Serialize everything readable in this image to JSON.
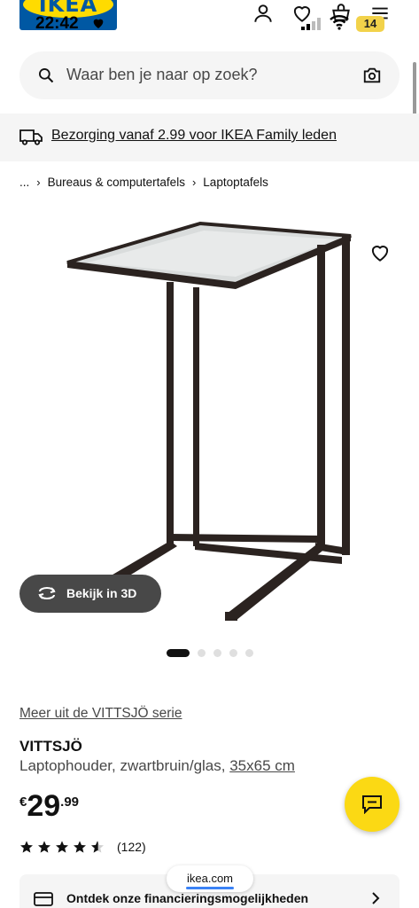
{
  "status_bar": {
    "time": "22:42",
    "battery": "14"
  },
  "header": {
    "logo_text": "IKEA"
  },
  "search": {
    "placeholder": "Waar ben je naar op zoek?"
  },
  "banner": {
    "text": "Bezorging vanaf 2.99 voor IKEA Family leden"
  },
  "breadcrumb": {
    "items": [
      "...",
      "Bureaus & computertafels",
      "Laptoptafels"
    ]
  },
  "gallery": {
    "view_3d_label": "Bekijk in 3D",
    "image_count": 5,
    "active_index": 0
  },
  "product": {
    "series_link": "Meer uit de VITTSJÖ serie",
    "name": "VITTSJÖ",
    "description": "Laptophouder, zwartbruin/glas, ",
    "size": "35x65 cm",
    "price_currency": "€",
    "price_int": "29",
    "price_dec": ".99",
    "rating_stars": 4.5,
    "rating_count": "(122)"
  },
  "finance": {
    "label": "Ontdek onze financieringsmogelijkheden"
  },
  "browser": {
    "url": "ikea.com"
  },
  "colors": {
    "ikea_blue": "#0058a3",
    "ikea_yellow": "#ffdb00",
    "chat_yellow": "#fbd914"
  }
}
